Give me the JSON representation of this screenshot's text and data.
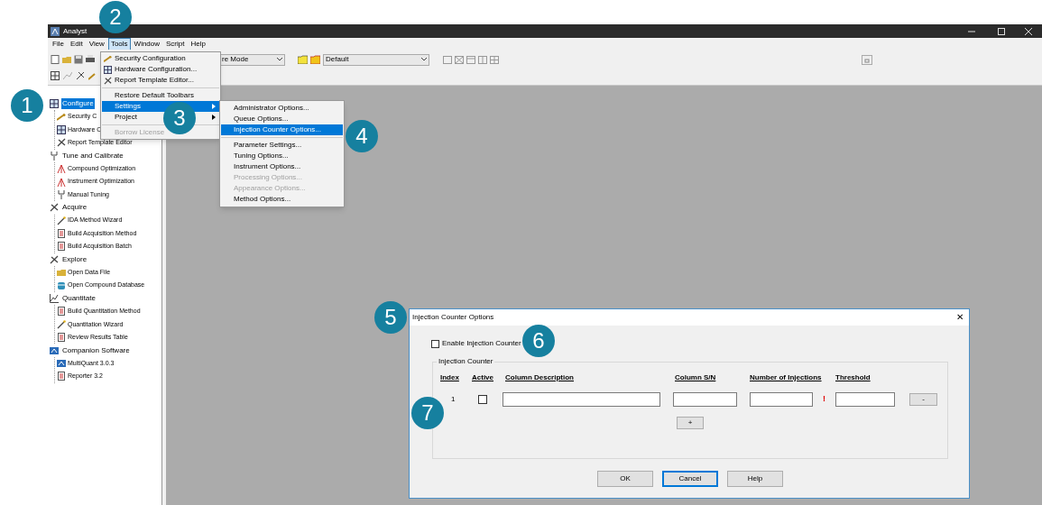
{
  "window": {
    "title": "Analyst"
  },
  "menu_bar": [
    {
      "label": "File",
      "selected": false
    },
    {
      "label": "Edit",
      "selected": false
    },
    {
      "label": "View",
      "selected": false
    },
    {
      "label": "Tools",
      "selected": true
    },
    {
      "label": "Window",
      "selected": false
    },
    {
      "label": "Script",
      "selected": false
    },
    {
      "label": "Help",
      "selected": false
    }
  ],
  "toolbar": {
    "mode_combo": "re Mode",
    "layout_combo": "Default"
  },
  "sidebar": {
    "groups": [
      {
        "label": "Configure",
        "selected": true,
        "children": [
          {
            "label": "Security C",
            "selected": false
          },
          {
            "label": "Hardware C",
            "selected": false
          },
          {
            "label": "Report Template Editor",
            "selected": false
          }
        ]
      },
      {
        "label": "Tune and Calibrate",
        "selected": false,
        "children": [
          {
            "label": "Compound Optimization",
            "selected": false
          },
          {
            "label": "Instrument Optimization",
            "selected": false
          },
          {
            "label": "Manual Tuning",
            "selected": false
          }
        ]
      },
      {
        "label": "Acquire",
        "selected": false,
        "children": [
          {
            "label": "IDA Method Wizard",
            "selected": false
          },
          {
            "label": "Build Acquisition Method",
            "selected": false
          },
          {
            "label": "Build Acquisition Batch",
            "selected": false
          }
        ]
      },
      {
        "label": "Explore",
        "selected": false,
        "children": [
          {
            "label": "Open Data File",
            "selected": false
          },
          {
            "label": "Open Compound Database",
            "selected": false
          }
        ]
      },
      {
        "label": "Quantitate",
        "selected": false,
        "children": [
          {
            "label": "Build Quantitation Method",
            "selected": false
          },
          {
            "label": "Quantitation Wizard",
            "selected": false
          },
          {
            "label": "Review Results Table",
            "selected": false
          }
        ]
      },
      {
        "label": "Companion Software",
        "selected": false,
        "children": [
          {
            "label": "MultiQuant 3.0.3",
            "selected": false
          },
          {
            "label": "Reporter 3.2",
            "selected": false
          }
        ]
      }
    ]
  },
  "tools_menu": {
    "items": [
      {
        "kind": "item",
        "label": "Security Configuration",
        "selected": false,
        "disabled": false,
        "has_submenu": false
      },
      {
        "kind": "item",
        "label": "Hardware Configuration...",
        "selected": false,
        "disabled": false,
        "has_submenu": false
      },
      {
        "kind": "item",
        "label": "Report Template Editor...",
        "selected": false,
        "disabled": false,
        "has_submenu": false
      },
      {
        "kind": "separator"
      },
      {
        "kind": "item",
        "label": "Restore Default Toolbars",
        "selected": false,
        "disabled": false,
        "has_submenu": false
      },
      {
        "kind": "item",
        "label": "Settings",
        "selected": true,
        "disabled": false,
        "has_submenu": true
      },
      {
        "kind": "item",
        "label": "Project",
        "selected": false,
        "disabled": false,
        "has_submenu": true
      },
      {
        "kind": "separator"
      },
      {
        "kind": "item",
        "label": "Borrow License",
        "selected": false,
        "disabled": true,
        "has_submenu": false
      }
    ]
  },
  "settings_submenu": {
    "items": [
      {
        "kind": "item",
        "label": "Administrator Options...",
        "selected": false,
        "disabled": false
      },
      {
        "kind": "item",
        "label": "Queue Options...",
        "selected": false,
        "disabled": false
      },
      {
        "kind": "item",
        "label": "Injection Counter Options...",
        "selected": true,
        "disabled": false
      },
      {
        "kind": "separator"
      },
      {
        "kind": "item",
        "label": "Parameter Settings...",
        "selected": false,
        "disabled": false
      },
      {
        "kind": "item",
        "label": "Tuning Options...",
        "selected": false,
        "disabled": false
      },
      {
        "kind": "item",
        "label": "Instrument Options...",
        "selected": false,
        "disabled": false
      },
      {
        "kind": "item",
        "label": "Processing Options...",
        "selected": false,
        "disabled": true
      },
      {
        "kind": "item",
        "label": "Appearance Options...",
        "selected": false,
        "disabled": true
      },
      {
        "kind": "item",
        "label": "Method Options...",
        "selected": false,
        "disabled": false
      }
    ]
  },
  "dialog": {
    "title": "Injection Counter Options",
    "close": "✕",
    "enable_checkbox": {
      "label": "Enable Injection Counter",
      "checked": false
    },
    "group_title": "Injection Counter",
    "columns": [
      "Index",
      "Active",
      "Column Description",
      "Column S/N",
      "Number of Injections",
      "Threshold"
    ],
    "rows": [
      {
        "index": "1",
        "active": false,
        "warning": "!",
        "remove_button": "-"
      }
    ],
    "add_button": "+",
    "buttons": [
      {
        "label": "OK",
        "default": false
      },
      {
        "label": "Cancel",
        "default": true
      },
      {
        "label": "Help",
        "default": false
      }
    ]
  },
  "callouts": [
    {
      "number": "1"
    },
    {
      "number": "2"
    },
    {
      "number": "3"
    },
    {
      "number": "4"
    },
    {
      "number": "5"
    },
    {
      "number": "6"
    },
    {
      "number": "7"
    }
  ]
}
